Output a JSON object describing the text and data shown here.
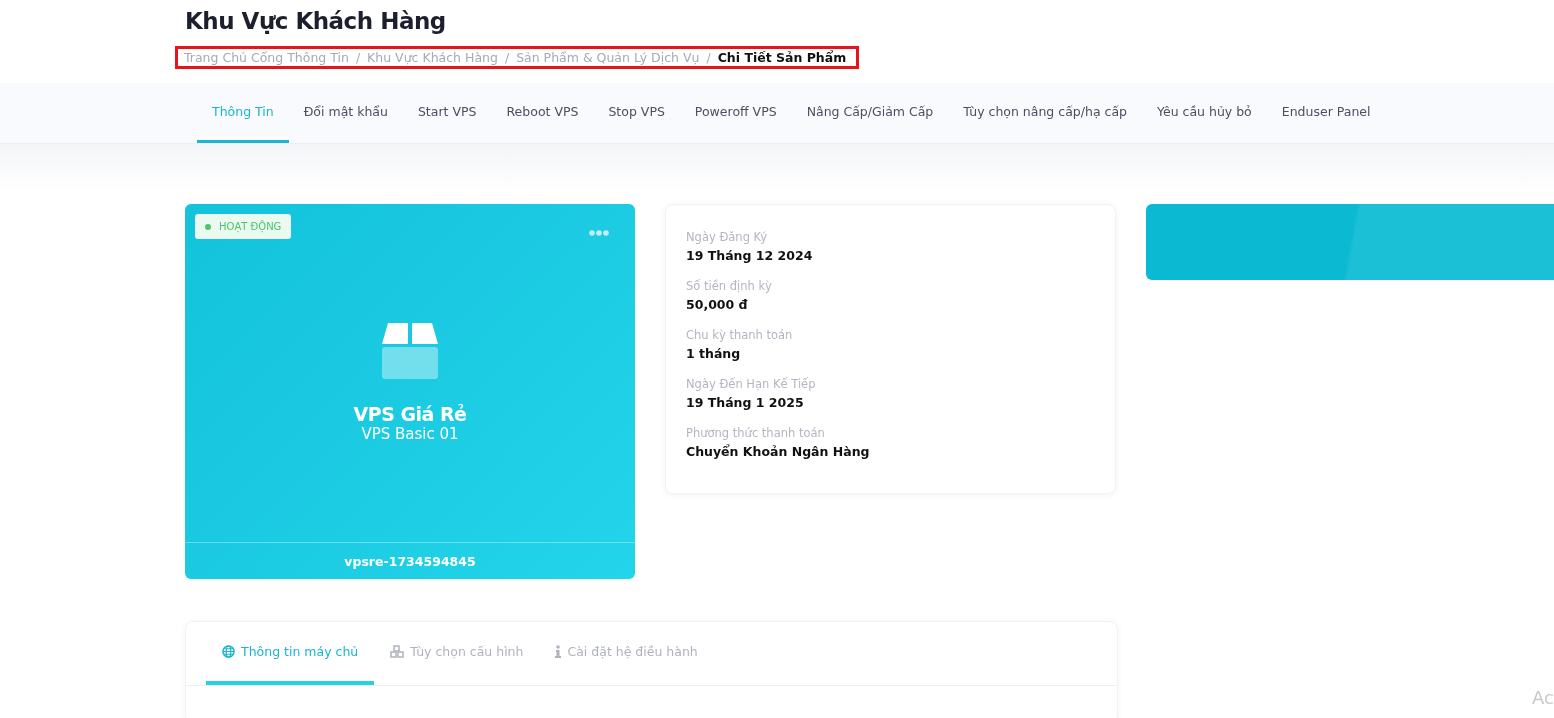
{
  "page": {
    "title": "Khu Vực Khách Hàng"
  },
  "breadcrumb_separator": "/",
  "breadcrumb": [
    {
      "label": "Trang Chủ Cổng Thông Tin",
      "selected": false
    },
    {
      "label": "Khu Vực Khách Hàng",
      "selected": false
    },
    {
      "label": "Sản Phẩm & Quản Lý Dịch Vụ",
      "selected": false
    },
    {
      "label": "Chi Tiết Sản Phẩm",
      "selected": true
    }
  ],
  "tabs": [
    {
      "label": "Thông Tin",
      "selected": true
    },
    {
      "label": "Đổi mật khẩu",
      "selected": false
    },
    {
      "label": "Start VPS",
      "selected": false
    },
    {
      "label": "Reboot VPS",
      "selected": false
    },
    {
      "label": "Stop VPS",
      "selected": false
    },
    {
      "label": "Poweroff VPS",
      "selected": false
    },
    {
      "label": "Nâng Cấp/Giảm Cấp",
      "selected": false
    },
    {
      "label": "Tùy chọn nâng cấp/hạ cấp",
      "selected": false
    },
    {
      "label": "Yêu cầu hủy bỏ",
      "selected": false
    },
    {
      "label": "Enduser Panel",
      "selected": false
    }
  ],
  "product_card": {
    "status": {
      "label": "HOẠT ĐỘNG",
      "color": "#4cc46a"
    },
    "name": "VPS Giá Rẻ",
    "plan": "VPS Basic 01",
    "hostname": "vpsre-1734594845"
  },
  "details": [
    {
      "label": "Ngày Đăng Ký",
      "value": "19 Tháng 12 2024"
    },
    {
      "label": "Số tiền định kỳ",
      "value": "50,000 đ"
    },
    {
      "label": "Chu kỳ thanh toán",
      "value": "1 tháng"
    },
    {
      "label": "Ngày Đến Hạn Kế Tiếp",
      "value": "19 Tháng 1 2025"
    },
    {
      "label": "Phương thức thanh toán",
      "value": "Chuyển Khoản Ngân Hàng"
    }
  ],
  "sub_tabs": [
    {
      "kind": "globe",
      "label": "Thông tin máy chủ",
      "selected": true
    },
    {
      "kind": "cubes",
      "label": "Tùy chọn cấu hình",
      "selected": false
    },
    {
      "kind": "info",
      "label": "Cài đặt hệ điều hành",
      "selected": false
    }
  ],
  "corner_text": "Ac"
}
